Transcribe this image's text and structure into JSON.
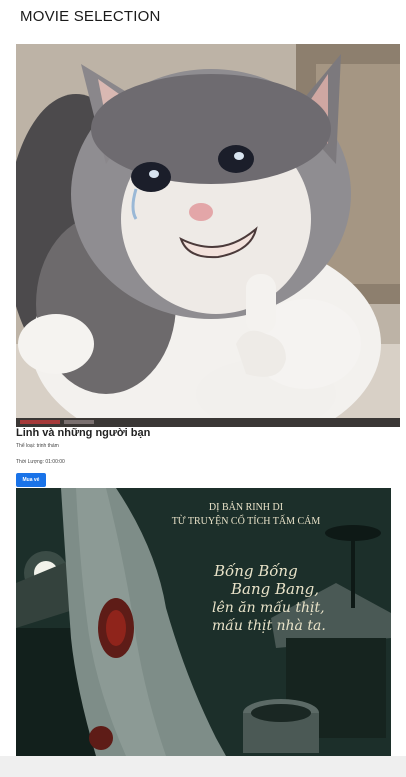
{
  "page": {
    "title": "MOVIE SELECTION"
  },
  "movies": [
    {
      "title": "Linh và những người bạn",
      "genre_text": "Thể loại: trinh thám",
      "duration_text": "Thời Lượng: 01:00:00",
      "buy_label": "Mua vé",
      "poster": "crying-cat-thumbs-up"
    },
    {
      "poster": "horror-leg-village",
      "poster_text": {
        "line1": "DỊ BẢN RINH DI",
        "line2": "TỪ TRUYỆN CỔ TÍCH TẤM CÁM",
        "verse1": "Bống Bống",
        "verse2": "Bang Bang,",
        "verse3": "lên ăn mấu thịt,",
        "verse4": "mấu thịt nhà ta."
      }
    }
  ],
  "colors": {
    "buy_button": "#1a73e8",
    "horror_bg": "#1c2f2a",
    "horror_text": "#e8e2c8"
  }
}
